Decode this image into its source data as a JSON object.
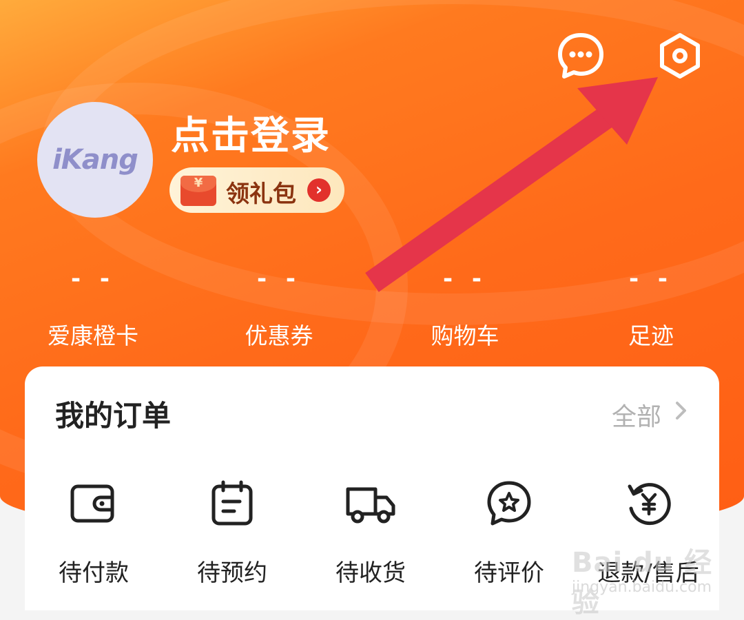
{
  "header": {
    "message_icon": "chat-bubble-icon",
    "settings_icon": "hexagon-settings-icon",
    "avatar_text": "iKang",
    "login_label": "点击登录",
    "gift": {
      "symbol": "¥",
      "label": "领礼包",
      "arrow": "›"
    },
    "stats": [
      {
        "value": "- -",
        "label": "爱康橙卡"
      },
      {
        "value": "- -",
        "label": "优惠券"
      },
      {
        "value": "- -",
        "label": "购物车"
      },
      {
        "value": "- -",
        "label": "足迹"
      }
    ]
  },
  "orders": {
    "title": "我的订单",
    "view_all": "全部",
    "items": [
      {
        "label": "待付款",
        "icon": "wallet-icon"
      },
      {
        "label": "待预约",
        "icon": "calendar-icon"
      },
      {
        "label": "待收货",
        "icon": "truck-icon"
      },
      {
        "label": "待评价",
        "icon": "star-bubble-icon"
      },
      {
        "label": "退款/售后",
        "icon": "refund-icon"
      }
    ]
  },
  "watermark": {
    "brand": "Bai du 经验",
    "url": "jingyan.baidu.com"
  },
  "colors": {
    "header_orange": "#ff6a1a",
    "annotation_arrow": "#e5354a",
    "gift_badge": "#e2312c"
  }
}
